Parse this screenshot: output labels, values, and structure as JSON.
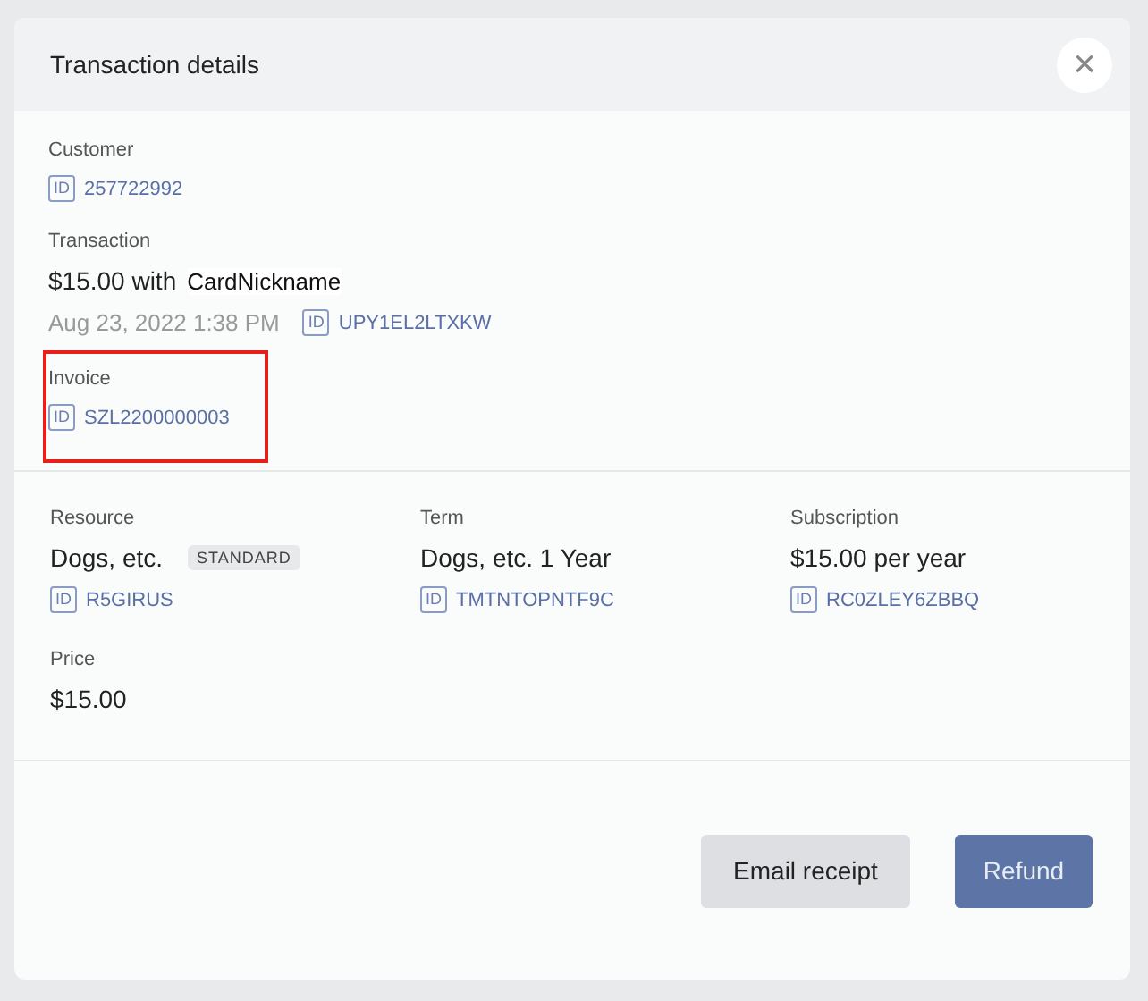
{
  "dialog": {
    "title": "Transaction details",
    "close_icon": "×"
  },
  "customer": {
    "label": "Customer",
    "id_tag": "ID",
    "id": "257722992"
  },
  "transaction": {
    "label": "Transaction",
    "amount": "$15.00 with",
    "card": "CardNickname",
    "date": "Aug 23, 2022 1:38 PM",
    "id_tag": "ID",
    "id": "UPY1EL2LTXKW"
  },
  "invoice": {
    "label": "Invoice",
    "id_tag": "ID",
    "id": "SZL2200000003",
    "highlighted": true
  },
  "details": [
    {
      "label": "Resource",
      "value": "Dogs, etc.",
      "badge": "STANDARD",
      "id_tag": "ID",
      "id": "R5GIRUS"
    },
    {
      "label": "Term",
      "value": "Dogs, etc. 1 Year",
      "id_tag": "ID",
      "id": "TMTNTOPNTF9C"
    },
    {
      "label": "Subscription",
      "value": "$15.00 per year",
      "id_tag": "ID",
      "id": "RC0ZLEY6ZBBQ"
    }
  ],
  "price": {
    "label": "Price",
    "value": "$15.00"
  },
  "buttons": [
    {
      "label": "Email receipt",
      "kind": "secondary"
    },
    {
      "label": "Refund",
      "kind": "primary"
    }
  ]
}
